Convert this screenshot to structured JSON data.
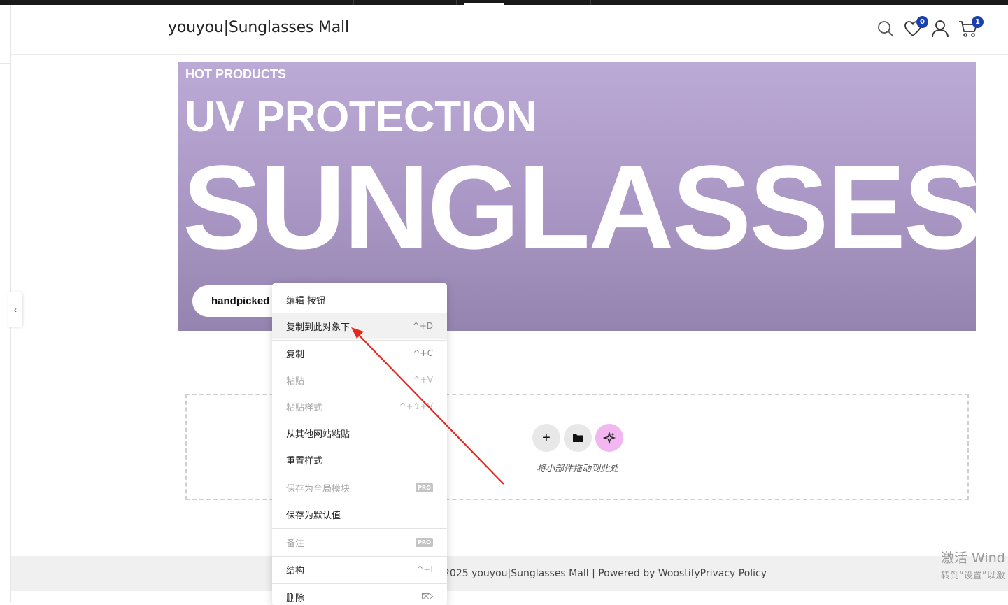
{
  "header": {
    "site_title": "youyou|Sunglasses Mall",
    "wishlist_count": "0",
    "cart_count": "1"
  },
  "hero": {
    "eyebrow": "HOT PRODUCTS",
    "headline": "UV PROTECTION",
    "big_text": "SUNGLASSES",
    "button_label": "handpicked"
  },
  "drop_zone": {
    "hint": "将小部件拖动到此处"
  },
  "footer": {
    "text": "2025 youyou|Sunglasses Mall | Powered by WoostifyPrivacy Policy"
  },
  "watermark": {
    "line1": "激活 Wind",
    "line2": "转到“设置”以激"
  },
  "context_menu": {
    "edit": "编辑 按钮",
    "duplicate": "复制到此对象下",
    "duplicate_sc": "^+D",
    "copy": "复制",
    "copy_sc": "^+C",
    "paste": "粘贴",
    "paste_sc": "^+V",
    "paste_style": "粘贴样式",
    "paste_style_sc": "^+⇧+V",
    "paste_other": "从其他网站粘贴",
    "reset_style": "重置样式",
    "save_global": "保存为全局模块",
    "pro_badge": "PRO",
    "save_default": "保存为默认值",
    "notes": "备注",
    "structure": "结构",
    "structure_sc": "^+I",
    "delete": "删除",
    "delete_sc": "⌦"
  },
  "icons": {
    "search": "search-icon",
    "wishlist": "heart-icon",
    "account": "user-icon",
    "cart": "cart-icon",
    "collapse": "chevron-left-icon",
    "add": "plus-icon",
    "template": "folder-icon",
    "ai": "sparkle-icon"
  },
  "colors": {
    "hero_top": "#bcaad6",
    "hero_bottom": "#9584af",
    "badge": "#1a3fb0",
    "ai_button": "#f2b6f0",
    "annotation_arrow": "#e8261e"
  }
}
